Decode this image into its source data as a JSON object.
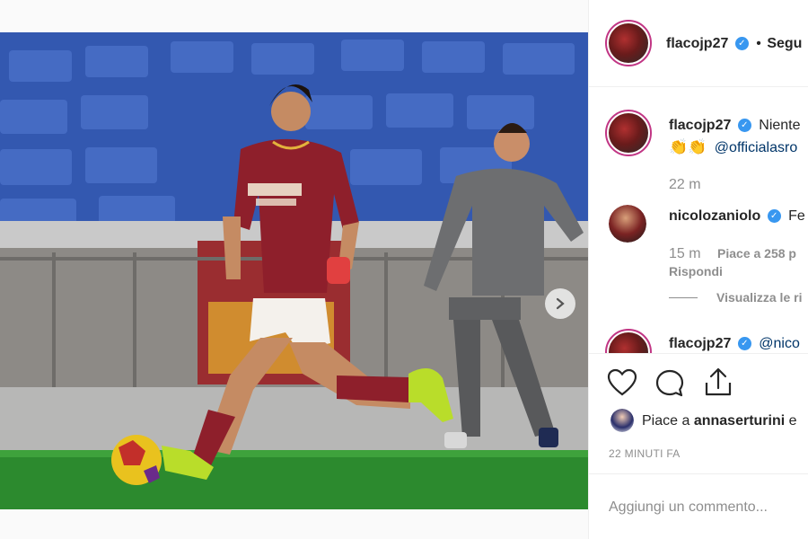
{
  "post": {
    "username": "flacojp27",
    "follow_separator": "•",
    "follow_label": "Segu"
  },
  "caption": {
    "username": "flacojp27",
    "text": "Niente",
    "emoji": "👏👏",
    "mention": "@officialasro",
    "time": "22 m"
  },
  "comments": [
    {
      "username": "nicolozaniolo",
      "text": "Fe",
      "time": "15 m",
      "likes": "Piace a 258 p",
      "reply": "Rispondi",
      "view_replies": "Visualizza le ri"
    },
    {
      "username": "flacojp27",
      "mention": "@nico"
    }
  ],
  "actions": {
    "like_icon": "heart-icon",
    "comment_icon": "comment-icon",
    "share_icon": "share-icon"
  },
  "likes_line": {
    "prefix": "Piace a",
    "user": "annaserturini",
    "suffix": "e"
  },
  "timestamp": "22 MINUTI FA",
  "add_comment_placeholder": "Aggiungi un commento...",
  "carousel": {
    "dot_count": 5,
    "active_index": 0
  },
  "colors": {
    "accent": "#3897f0",
    "story_ring": "#c13584",
    "roma_red": "#8e1f2b"
  }
}
